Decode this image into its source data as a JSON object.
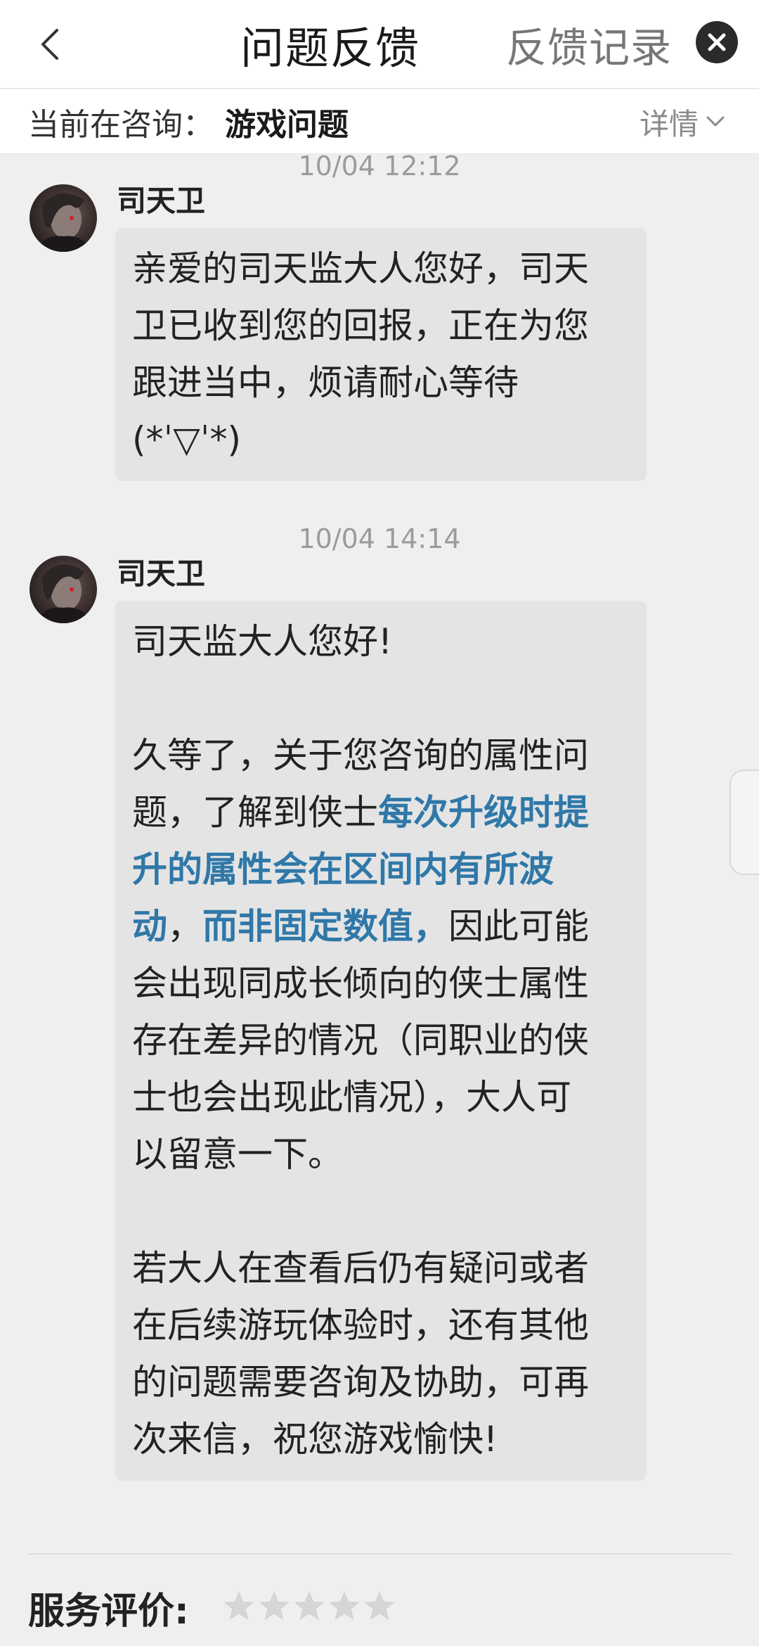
{
  "navbar": {
    "title": "问题反馈",
    "records_label": "反馈记录"
  },
  "consult": {
    "label": "当前在咨询：",
    "topic": "游戏问题",
    "details_label": "详情"
  },
  "messages": [
    {
      "timestamp": "10/04 12:12",
      "sender": "司天卫",
      "lines": [
        "亲爱的司天监大人您好，司天",
        "卫已收到您的回报，正在为您",
        "跟进当中，烦请耐心等待",
        "(*ˈ▽ˈ*)"
      ]
    },
    {
      "timestamp": "10/04 14:14",
      "sender": "司天卫",
      "greeting": "司天监大人您好!",
      "para2": {
        "l1": "久等了，关于您咨询的属性问",
        "l2_plain": "题，了解到侠士",
        "l2_hl": "每次升级时提",
        "l3_hl": "升的属性会在区间内有所波",
        "l4_hl1": "动",
        "l4_plain1": "，",
        "l4_hl2": "而非固定数值，",
        "l4_plain2": "因此可能",
        "l5": "会出现同成长倾向的侠士属性",
        "l6": "存在差异的情况（同职业的侠",
        "l7": "士也会出现此情况），大人可",
        "l8": "以留意一下。"
      },
      "para3": [
        "若大人在查看后仍有疑问或者",
        "在后续游玩体验时，还有其他",
        "的问题需要咨询及协助，可再",
        "次来信，祝您游戏愉快!"
      ]
    }
  ],
  "rating": {
    "label": "服务评价:",
    "stars_selected": 0,
    "stars_total": 5
  },
  "colors": {
    "highlight": "#2f78a8",
    "bubble": "#e4e4e5",
    "background": "#efeff0"
  }
}
